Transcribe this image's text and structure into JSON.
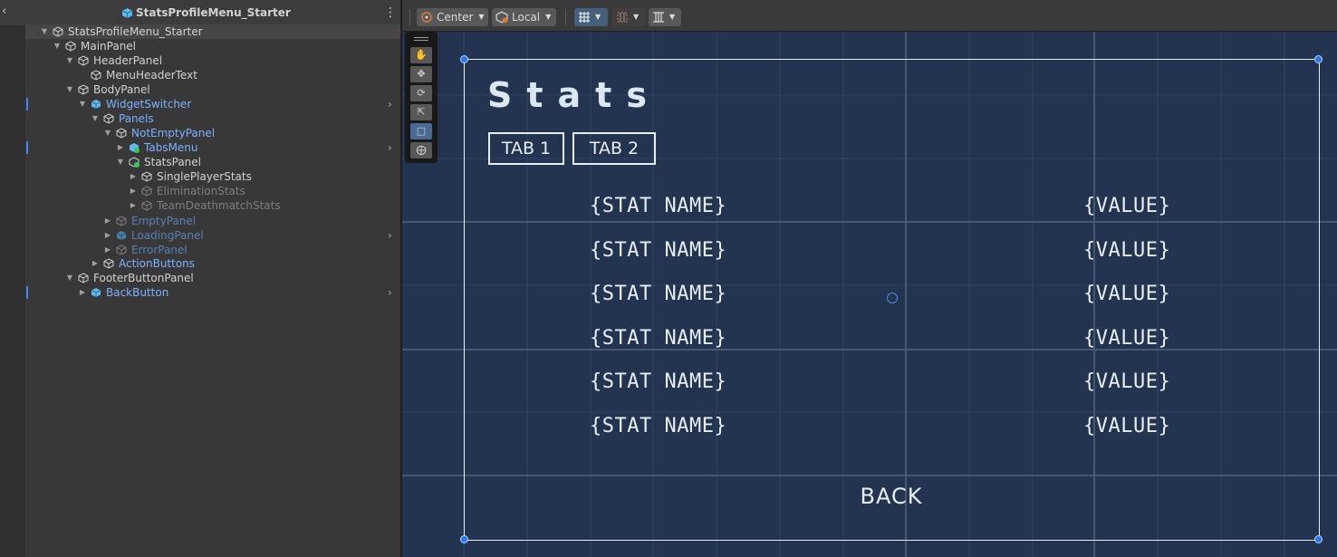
{
  "hierarchy": {
    "title": "StatsProfileMenu_Starter",
    "rows": [
      {
        "label": "StatsProfileMenu_Starter"
      },
      {
        "label": "MainPanel"
      },
      {
        "label": "HeaderPanel"
      },
      {
        "label": "MenuHeaderText"
      },
      {
        "label": "BodyPanel"
      },
      {
        "label": "WidgetSwitcher"
      },
      {
        "label": "Panels"
      },
      {
        "label": "NotEmptyPanel"
      },
      {
        "label": "TabsMenu"
      },
      {
        "label": "StatsPanel"
      },
      {
        "label": "SinglePlayerStats"
      },
      {
        "label": "EliminationStats"
      },
      {
        "label": "TeamDeathmatchStats"
      },
      {
        "label": "EmptyPanel"
      },
      {
        "label": "LoadingPanel"
      },
      {
        "label": "ErrorPanel"
      },
      {
        "label": "ActionButtons"
      },
      {
        "label": "FooterButtonPanel"
      },
      {
        "label": "BackButton"
      }
    ]
  },
  "toolbar": {
    "pivot_label": "Center",
    "space_label": "Local"
  },
  "canvas": {
    "title": "Stats",
    "tabs": [
      "TAB 1",
      "TAB 2"
    ],
    "stats": [
      {
        "name": "{STAT NAME}",
        "value": "{VALUE}"
      },
      {
        "name": "{STAT NAME}",
        "value": "{VALUE}"
      },
      {
        "name": "{STAT NAME}",
        "value": "{VALUE}"
      },
      {
        "name": "{STAT NAME}",
        "value": "{VALUE}"
      },
      {
        "name": "{STAT NAME}",
        "value": "{VALUE}"
      },
      {
        "name": "{STAT NAME}",
        "value": "{VALUE}"
      }
    ],
    "back_label": "BACK"
  },
  "colors": {
    "scene_bg": "#22344f",
    "prefab_blue": "#7cb1ff",
    "selection_handle": "#2f77e6"
  }
}
